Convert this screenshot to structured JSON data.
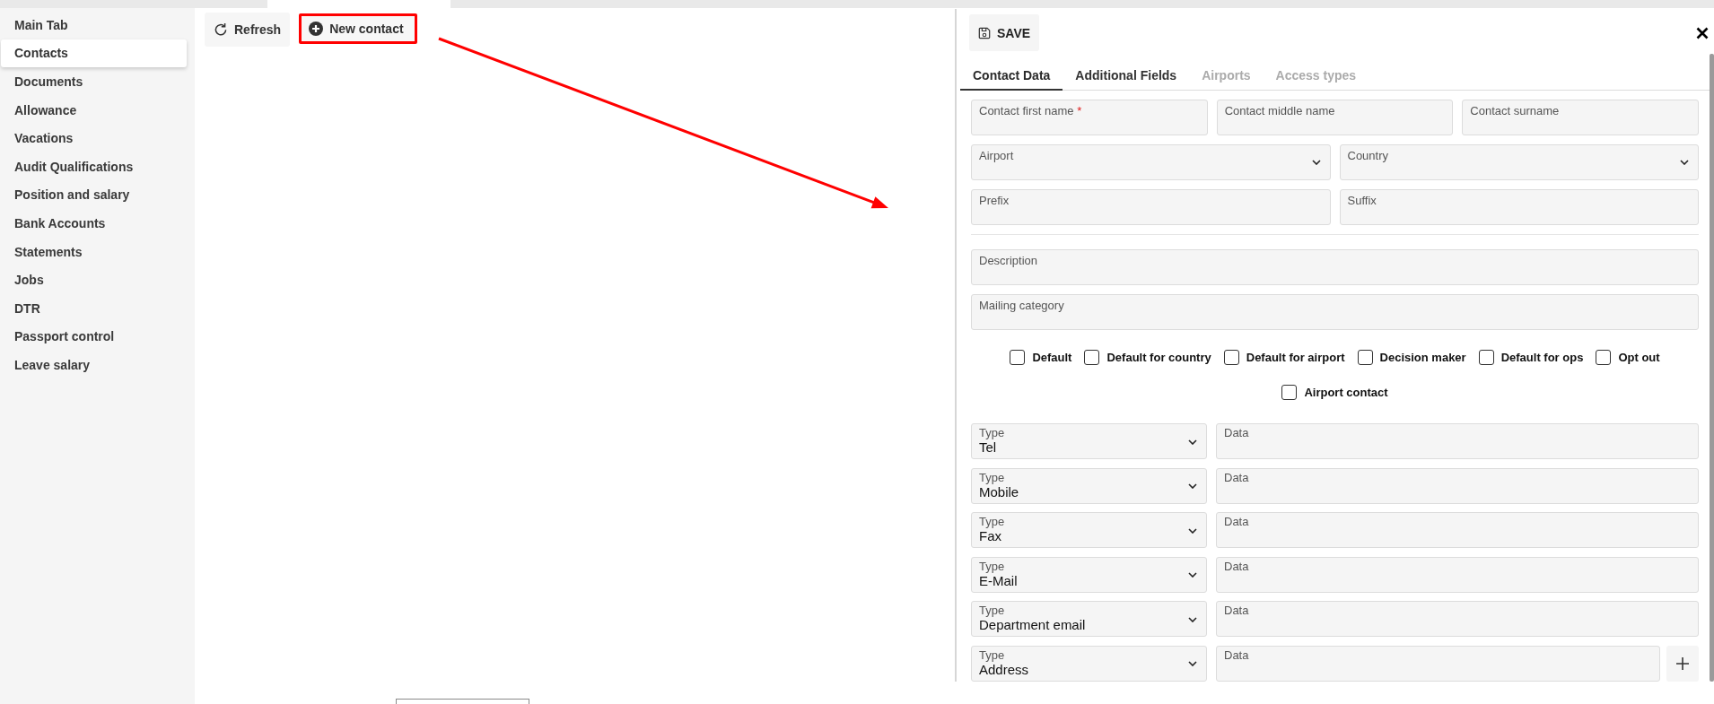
{
  "sidebar": {
    "items": [
      {
        "label": "Main Tab",
        "selected": false
      },
      {
        "label": "Contacts",
        "selected": true
      },
      {
        "label": "Documents",
        "selected": false
      },
      {
        "label": "Allowance",
        "selected": false
      },
      {
        "label": "Vacations",
        "selected": false
      },
      {
        "label": "Audit Qualifications",
        "selected": false
      },
      {
        "label": "Position and salary",
        "selected": false
      },
      {
        "label": "Bank Accounts",
        "selected": false
      },
      {
        "label": "Statements",
        "selected": false
      },
      {
        "label": "Jobs",
        "selected": false
      },
      {
        "label": "DTR",
        "selected": false
      },
      {
        "label": "Passport control",
        "selected": false
      },
      {
        "label": "Leave salary",
        "selected": false
      }
    ]
  },
  "toolbar": {
    "buttons": [
      {
        "kind": "refresh",
        "label": "Refresh",
        "annotated": false
      },
      {
        "kind": "add",
        "label": "New contact",
        "annotated": true
      }
    ]
  },
  "contact_panel": {
    "save_button": {
      "label": "SAVE"
    },
    "tabs": [
      {
        "label": "Contact Data",
        "selected": true,
        "disabled": false
      },
      {
        "label": "Additional Fields",
        "selected": false,
        "disabled": false
      },
      {
        "label": "Airports",
        "selected": false,
        "disabled": true
      },
      {
        "label": "Access types",
        "selected": false,
        "disabled": true
      }
    ],
    "field_rows": [
      {
        "fields": [
          {
            "kind": "text",
            "label": "Contact first name",
            "required_mark": "*"
          },
          {
            "kind": "text",
            "label": "Contact middle name"
          },
          {
            "kind": "text",
            "label": "Contact surname"
          }
        ]
      },
      {
        "fields": [
          {
            "kind": "select",
            "label": "Airport"
          },
          {
            "kind": "select",
            "label": "Country"
          }
        ]
      },
      {
        "fields": [
          {
            "kind": "text",
            "label": "Prefix"
          },
          {
            "kind": "text",
            "label": "Suffix"
          }
        ]
      }
    ],
    "notes_fields": [
      {
        "label": "Description"
      },
      {
        "label": "Mailing category"
      }
    ],
    "checkboxes": [
      {
        "label": "Default",
        "checked": false
      },
      {
        "label": "Default for country",
        "checked": false
      },
      {
        "label": "Default for airport",
        "checked": false
      },
      {
        "label": "Decision maker",
        "checked": false
      },
      {
        "label": "Default for ops",
        "checked": false
      },
      {
        "label": "Opt out",
        "checked": false
      },
      {
        "label": "Airport contact",
        "checked": false
      }
    ],
    "contact_methods": [
      {
        "type_label": "Type",
        "type": "Tel",
        "data_label": "Data"
      },
      {
        "type_label": "Type",
        "type": "Mobile",
        "data_label": "Data"
      },
      {
        "type_label": "Type",
        "type": "Fax",
        "data_label": "Data"
      },
      {
        "type_label": "Type",
        "type": "E-Mail",
        "data_label": "Data"
      },
      {
        "type_label": "Type",
        "type": "Department email",
        "data_label": "Data"
      },
      {
        "type_label": "Type",
        "type": "Address",
        "data_label": "Data"
      }
    ]
  }
}
